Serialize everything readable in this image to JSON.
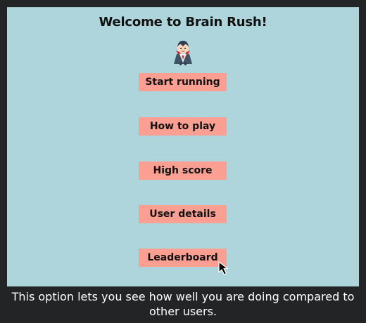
{
  "game": {
    "title": "Welcome to Brain Rush!",
    "mascot_icon": "vampire-icon",
    "menu": [
      {
        "label": "Start running"
      },
      {
        "label": "How to play"
      },
      {
        "label": "High score"
      },
      {
        "label": "User details"
      },
      {
        "label": "Leaderboard"
      }
    ]
  },
  "caption": {
    "text": "This option lets you see how well you are doing compared to other users."
  },
  "colors": {
    "panel_background": "#afd5dc",
    "button_background": "#fb9f93",
    "page_background": "#222426"
  }
}
